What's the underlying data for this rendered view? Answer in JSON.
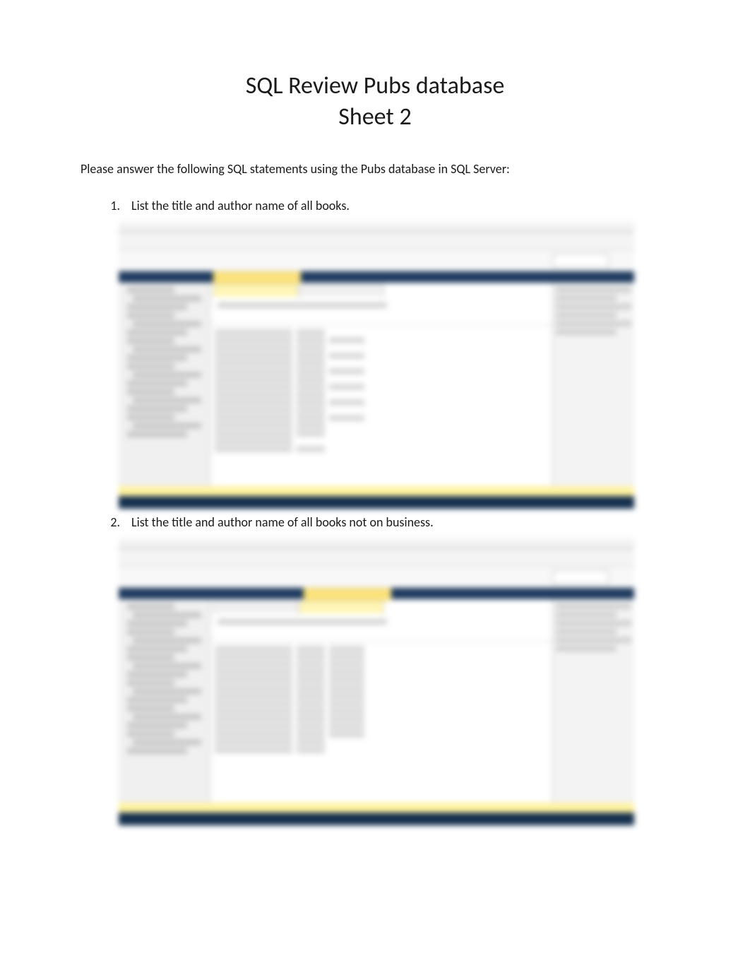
{
  "title": {
    "line1": "SQL Review Pubs database",
    "line2": "Sheet 2"
  },
  "intro": "Please answer the following SQL statements using the Pubs database in SQL Server:",
  "questions": [
    {
      "number": "1.",
      "text": "List the title and author name of all books."
    },
    {
      "number": "2.",
      "text": "List the title and author name of all books not on business."
    }
  ]
}
